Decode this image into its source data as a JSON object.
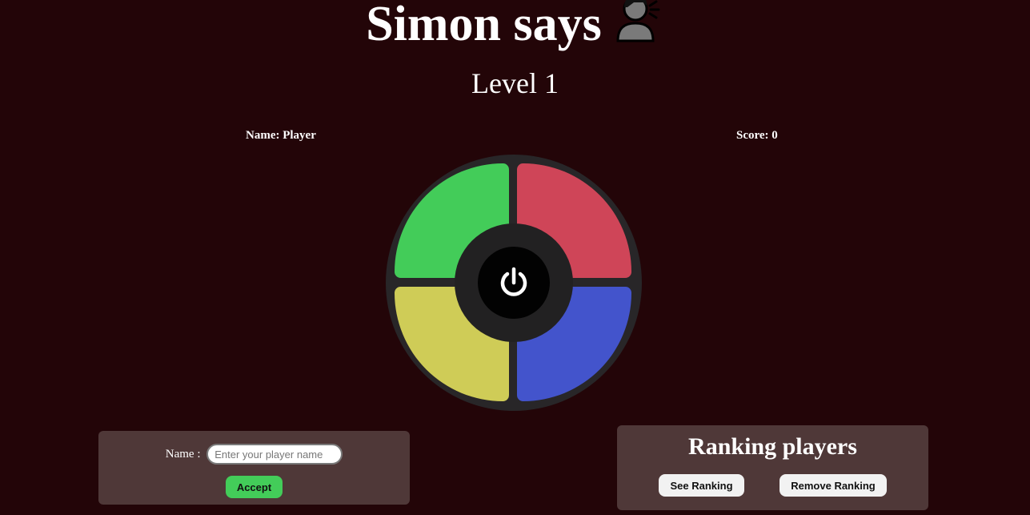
{
  "header": {
    "title": "Simon says",
    "title_icon": "speaking-person-icon",
    "level": "Level 1"
  },
  "player": {
    "name_label": "Name: Player",
    "score_label": "Score: 0"
  },
  "board": {
    "pads": [
      {
        "id": "green",
        "color": "#43cc59"
      },
      {
        "id": "red",
        "color": "#cf4558"
      },
      {
        "id": "yellow",
        "color": "#cfcc57"
      },
      {
        "id": "blue",
        "color": "#4354cc"
      }
    ],
    "power_icon": "power-icon"
  },
  "name_form": {
    "label": "Name :",
    "placeholder": "Enter your player name",
    "value": "",
    "accept_label": "Accept"
  },
  "ranking": {
    "title": "Ranking players",
    "see_label": "See Ranking",
    "remove_label": "Remove Ranking"
  },
  "colors": {
    "background": "#230508",
    "panel": "#4f3838",
    "accent": "#43cc59"
  }
}
